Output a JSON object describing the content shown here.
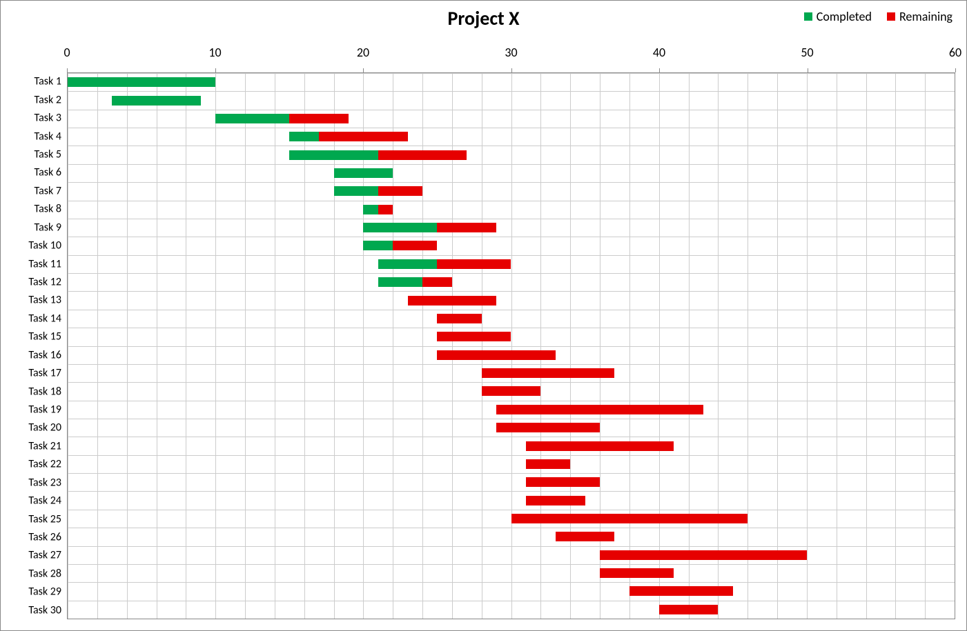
{
  "chart_data": {
    "type": "bar",
    "orientation": "horizontal",
    "stacked": true,
    "title": "Project X",
    "legend": [
      {
        "name": "Completed",
        "color": "#00a84f"
      },
      {
        "name": "Remaining",
        "color": "#e60000"
      }
    ],
    "xlim": [
      0,
      60
    ],
    "xticks": [
      0,
      10,
      20,
      30,
      40,
      50,
      60
    ],
    "xminor_step": 2,
    "categories": [
      "Task 1",
      "Task 2",
      "Task 3",
      "Task 4",
      "Task 5",
      "Task 6",
      "Task 7",
      "Task 8",
      "Task 9",
      "Task 10",
      "Task 11",
      "Task 12",
      "Task 13",
      "Task 14",
      "Task 15",
      "Task 16",
      "Task 17",
      "Task 18",
      "Task 19",
      "Task 20",
      "Task 21",
      "Task 22",
      "Task 23",
      "Task 24",
      "Task 25",
      "Task 26",
      "Task 27",
      "Task 28",
      "Task 29",
      "Task 30"
    ],
    "series": [
      {
        "name": "start_offset",
        "invisible": true,
        "values": [
          0,
          3,
          10,
          15,
          15,
          18,
          18,
          20,
          20,
          20,
          21,
          21,
          23,
          25,
          25,
          25,
          28,
          28,
          29,
          29,
          31,
          31,
          31,
          31,
          30,
          33,
          36,
          36,
          38,
          40
        ]
      },
      {
        "name": "Completed",
        "color": "#00a84f",
        "values": [
          10,
          6,
          5,
          2,
          6,
          4,
          3,
          1,
          5,
          2,
          4,
          3,
          0,
          0,
          0,
          0,
          0,
          0,
          0,
          0,
          0,
          0,
          0,
          0,
          0,
          0,
          0,
          0,
          0,
          0
        ]
      },
      {
        "name": "Remaining",
        "color": "#e60000",
        "values": [
          0,
          0,
          4,
          6,
          6,
          0,
          3,
          1,
          4,
          3,
          5,
          2,
          6,
          3,
          5,
          8,
          9,
          4,
          14,
          7,
          10,
          3,
          5,
          4,
          16,
          4,
          14,
          5,
          7,
          4
        ]
      }
    ],
    "grid": {
      "vertical_major": true,
      "vertical_minor": true,
      "horizontal_rows": true
    }
  }
}
